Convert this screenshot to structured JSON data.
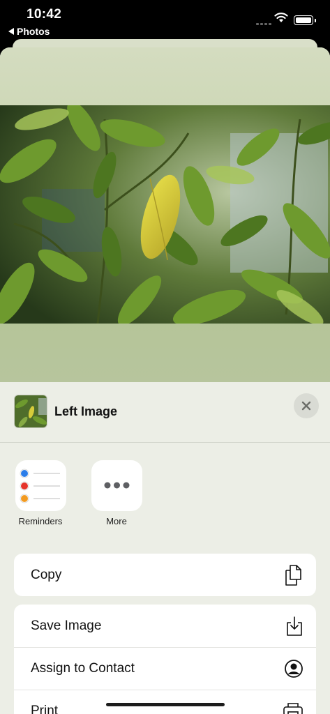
{
  "status_bar": {
    "time": "10:42",
    "back_app": "Photos"
  },
  "sheet": {
    "title": "Left Image",
    "close_icon": "close-icon",
    "apps": [
      {
        "label": "Reminders",
        "icon": "reminders-icon"
      },
      {
        "label": "More",
        "icon": "more-icon"
      }
    ],
    "actions_group1": [
      {
        "label": "Copy",
        "icon": "copy-icon"
      }
    ],
    "actions_group2": [
      {
        "label": "Save Image",
        "icon": "save-image-icon"
      },
      {
        "label": "Assign to Contact",
        "icon": "contact-icon"
      },
      {
        "label": "Print",
        "icon": "print-icon"
      }
    ]
  },
  "colors": {
    "sheet_bg": "#eceee6",
    "reminder_blue": "#2b7de9",
    "reminder_red": "#e5342b",
    "reminder_orange": "#f29a20"
  }
}
